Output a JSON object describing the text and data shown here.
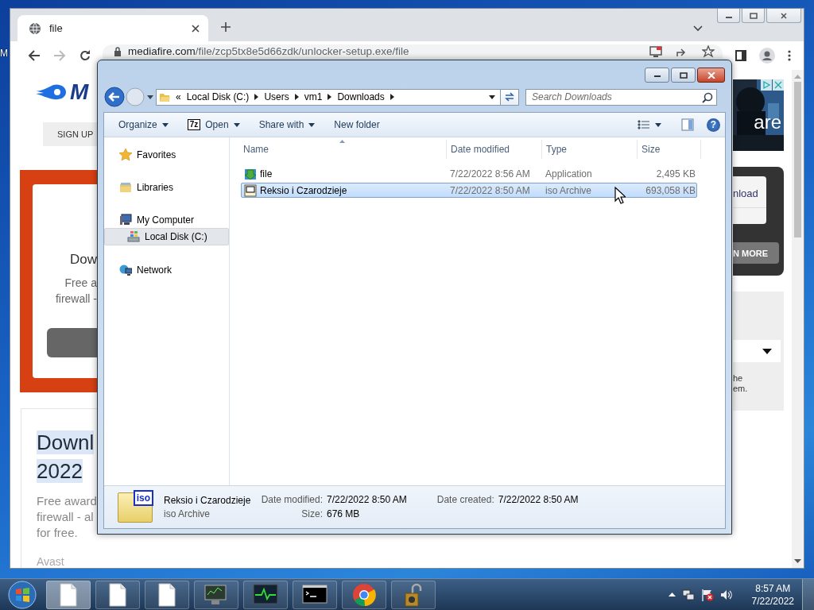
{
  "desktop": {
    "icon_label": "M"
  },
  "browser": {
    "tabs": [
      {
        "title": "file",
        "selected": true
      }
    ],
    "forward_disabled": true,
    "url_host": "mediafire.com",
    "url_path": "/file/zcp5tx8e5d66zdk/unlocker-setup.exe/file",
    "page_left": {
      "logo_text": "M",
      "sign_up": "SIGN UP",
      "card_heading": "Dow",
      "card_lines": [
        "Free a",
        "firewall -"
      ],
      "heading_lines": [
        "Downl",
        "2022"
      ],
      "text_lines": [
        "Free award",
        "firewall - al",
        "for free."
      ],
      "source": "Avast"
    },
    "page_right": {
      "ad_text": "are",
      "link": "nload",
      "learn_more": "N MORE",
      "note_lines": [
        "he",
        "em."
      ]
    }
  },
  "explorer": {
    "overflow": "«",
    "breadcrumb": [
      "Local Disk (C:)",
      "Users",
      "vm1",
      "Downloads"
    ],
    "search": {
      "placeholder": "Search Downloads"
    },
    "toolbar": [
      {
        "label": "Organize",
        "kind": "menu"
      },
      {
        "label": "Open",
        "kind": "menu",
        "badge": "7z"
      },
      {
        "label": "Share with",
        "kind": "menu"
      },
      {
        "label": "New folder",
        "kind": "plain"
      }
    ],
    "help": "?",
    "nav": [
      {
        "label": "Favorites",
        "kind": "favorites",
        "selected": false
      },
      {
        "label": "Libraries",
        "kind": "libraries",
        "selected": false
      },
      {
        "label": "My Computer",
        "kind": "computer",
        "selected": false,
        "children": [
          {
            "label": "Local Disk (C:)",
            "kind": "drive",
            "selected": true
          }
        ]
      },
      {
        "label": "Network",
        "kind": "network",
        "selected": false
      }
    ],
    "columns": [
      "Name",
      "Date modified",
      "Type",
      "Size"
    ],
    "files": [
      {
        "name": "file",
        "date": "7/22/2022 8:56 AM",
        "type": "Application",
        "size": "2,495 KB",
        "kind": "application",
        "selected": false
      },
      {
        "name": "Reksio i Czarodzieje",
        "date": "7/22/2022 8:50 AM",
        "type": "iso Archive",
        "size": "693,058 KB",
        "kind": "iso",
        "selected": true
      }
    ],
    "details": {
      "icon_text": "iso",
      "name": "Reksio i Czarodzieje",
      "type": "iso Archive",
      "fields": [
        {
          "label": "Date modified:",
          "value": "7/22/2022 8:50 AM"
        },
        {
          "label": "Size:",
          "value": "676 MB"
        },
        {
          "label": "Date created:",
          "value": "7/22/2022 8:50 AM"
        }
      ]
    }
  },
  "taskbar": {
    "items": [
      {
        "kind": "document",
        "active": true
      },
      {
        "kind": "document",
        "active": false
      },
      {
        "kind": "document",
        "active": false
      },
      {
        "kind": "monitor",
        "active": false
      },
      {
        "kind": "activity",
        "active": false
      },
      {
        "kind": "terminal",
        "active": false
      },
      {
        "kind": "chrome",
        "active": false
      },
      {
        "kind": "lock",
        "active": false
      }
    ],
    "time": "8:57 AM",
    "date": "7/22/2022"
  }
}
